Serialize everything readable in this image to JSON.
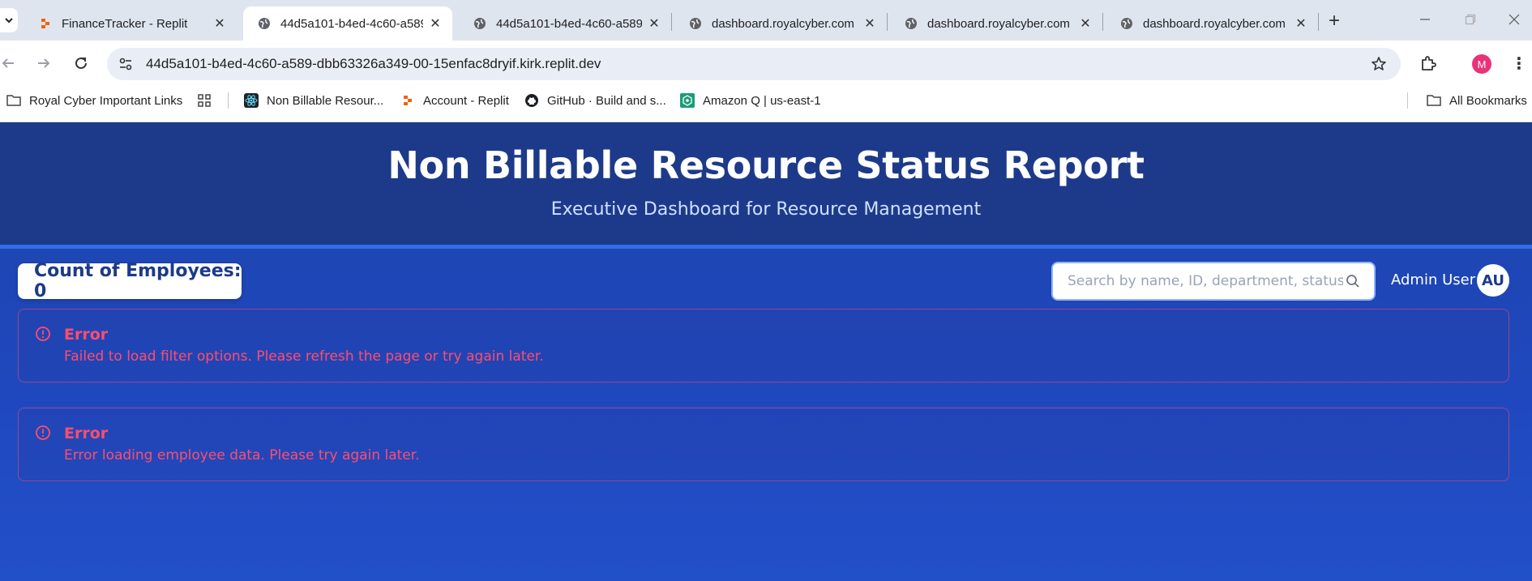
{
  "browser": {
    "tabs": [
      {
        "title": "FinanceTracker - Replit",
        "favicon": "replit-icon",
        "active": false
      },
      {
        "title": "44d5a101-b4ed-4c60-a589",
        "favicon": "globe-icon",
        "active": true
      },
      {
        "title": "44d5a101-b4ed-4c60-a589",
        "favicon": "globe-icon",
        "active": false
      },
      {
        "title": "dashboard.royalcyber.com",
        "favicon": "globe-icon",
        "active": false
      },
      {
        "title": "dashboard.royalcyber.com",
        "favicon": "globe-icon",
        "active": false
      },
      {
        "title": "dashboard.royalcyber.com",
        "favicon": "globe-icon",
        "active": false
      }
    ],
    "url": "44d5a101-b4ed-4c60-a589-dbb63326a349-00-15enfac8dryif.kirk.replit.dev",
    "profile_initial": "M",
    "bookmarks": [
      {
        "label": "Royal Cyber Important Links",
        "icon": "folder-icon"
      },
      {
        "label": "",
        "icon": "apps-grid-icon"
      },
      {
        "label": "Non Billable Resour...",
        "icon": "react-icon"
      },
      {
        "label": "Account - Replit",
        "icon": "replit-icon"
      },
      {
        "label": "GitHub · Build and s...",
        "icon": "github-icon"
      },
      {
        "label": "Amazon Q | us-east-1",
        "icon": "amazon-q-icon"
      }
    ],
    "all_bookmarks": "All Bookmarks"
  },
  "page": {
    "title": "Non Billable Resource Status Report",
    "subtitle": "Executive Dashboard for Resource Management",
    "count_label": "Count of Employees: 0",
    "search_placeholder": "Search by name, ID, department, status...",
    "user_name": "Admin User",
    "user_initials": "AU",
    "errors": [
      {
        "title": "Error",
        "message": "Failed to load filter options. Please refresh the page or try again later."
      },
      {
        "title": "Error",
        "message": "Error loading employee data. Please try again later."
      }
    ]
  },
  "colors": {
    "header_bg": "#1d3a8a",
    "accent_line": "#2f6ee8",
    "error_text": "#ff4d6d"
  }
}
